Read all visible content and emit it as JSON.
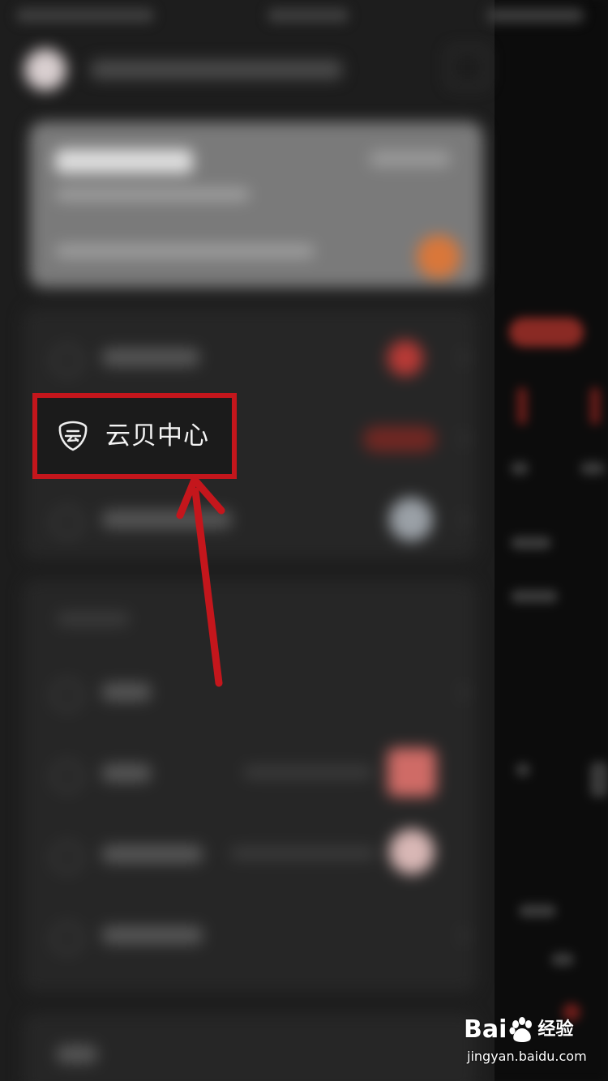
{
  "drawer": {
    "highlighted_item": {
      "label": "云贝中心",
      "icon": "yunbei-shield-icon"
    }
  },
  "annotation": {
    "box_color": "#c4161c",
    "arrow_color": "#c4161c"
  },
  "watermark": {
    "brand_prefix": "Bai",
    "brand_suffix": "经验",
    "url": "jingyan.baidu.com"
  }
}
